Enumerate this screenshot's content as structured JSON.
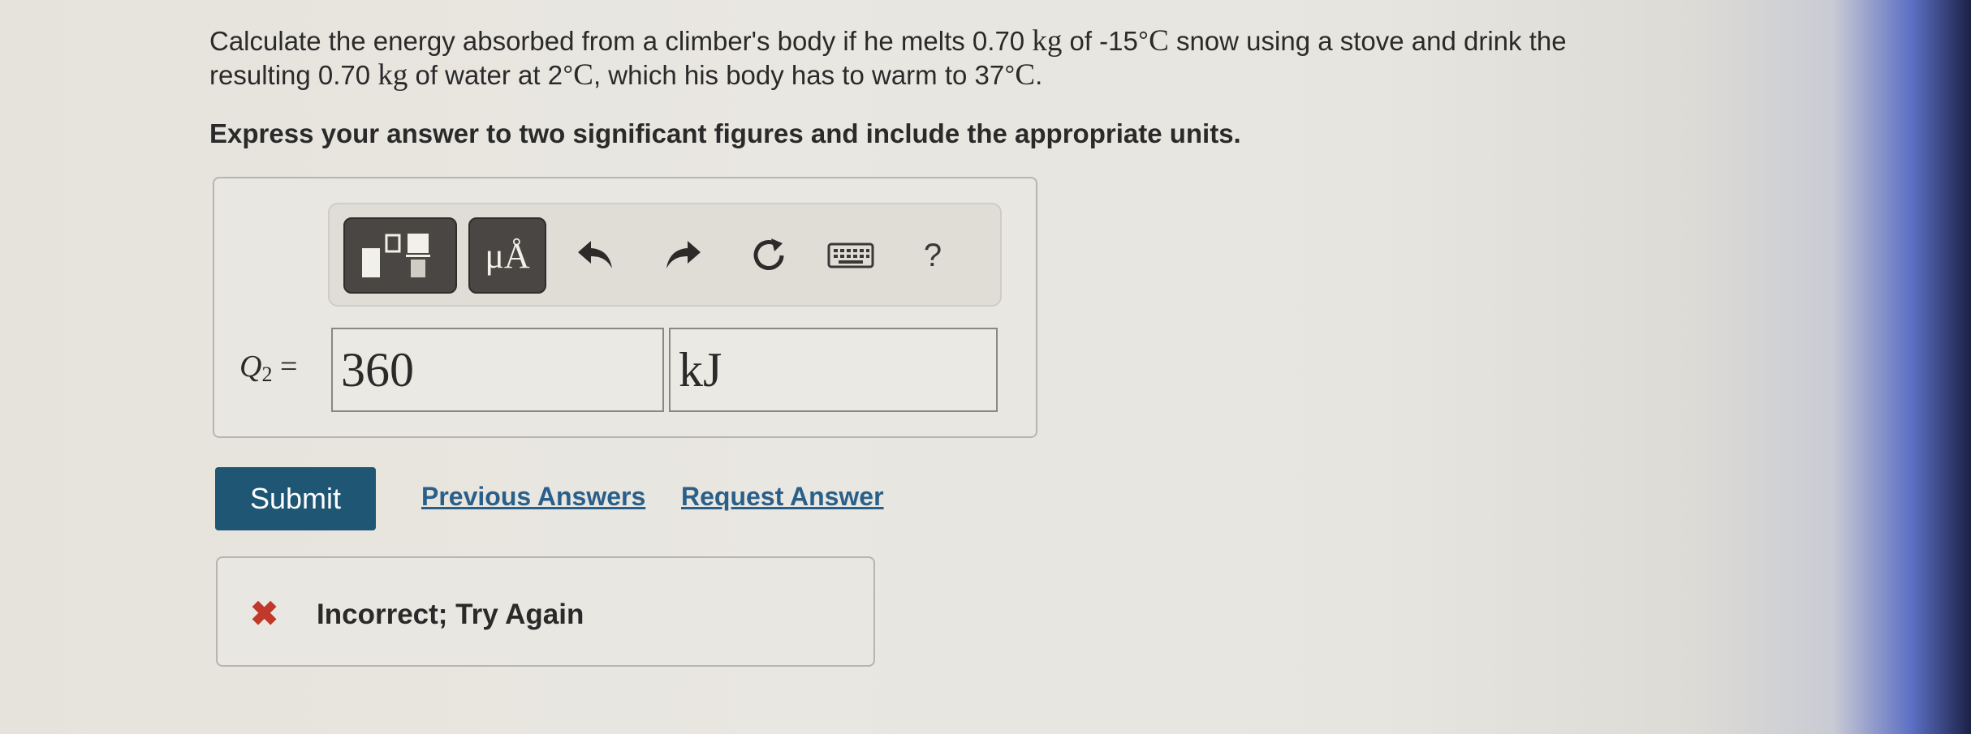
{
  "question": {
    "line1_a": "Calculate the energy absorbed from a climber's body if he melts 0.70 ",
    "line1_unit1": "kg",
    "line1_b": " of -15°",
    "line1_unit2": "C",
    "line1_c": " snow using a stove and drink the",
    "line2_a": "resulting 0.70 ",
    "line2_unit1": "kg",
    "line2_b": " of water at 2°",
    "line2_unit2": "C",
    "line2_c": ", which his body has to warm to 37°",
    "line2_unit3": "C",
    "line2_d": "."
  },
  "instruction": "Express your answer to two significant figures and include the appropriate units.",
  "toolbar": {
    "units_label": "μÅ",
    "help_label": "?",
    "icons": [
      "templates-icon",
      "units-icon",
      "undo-icon",
      "redo-icon",
      "reset-icon",
      "keyboard-icon",
      "help-icon"
    ]
  },
  "answer": {
    "label_var": "Q",
    "label_sub": "2",
    "label_eq": " =",
    "value": "360",
    "unit": "kJ"
  },
  "actions": {
    "submit": "Submit",
    "previous_answers": "Previous Answers",
    "request_answer": "Request Answer"
  },
  "feedback": {
    "icon": "✖",
    "text": "Incorrect; Try Again",
    "color": "#c0392b"
  },
  "colors": {
    "submit_bg": "#1e5673",
    "link": "#2a5f8a"
  }
}
